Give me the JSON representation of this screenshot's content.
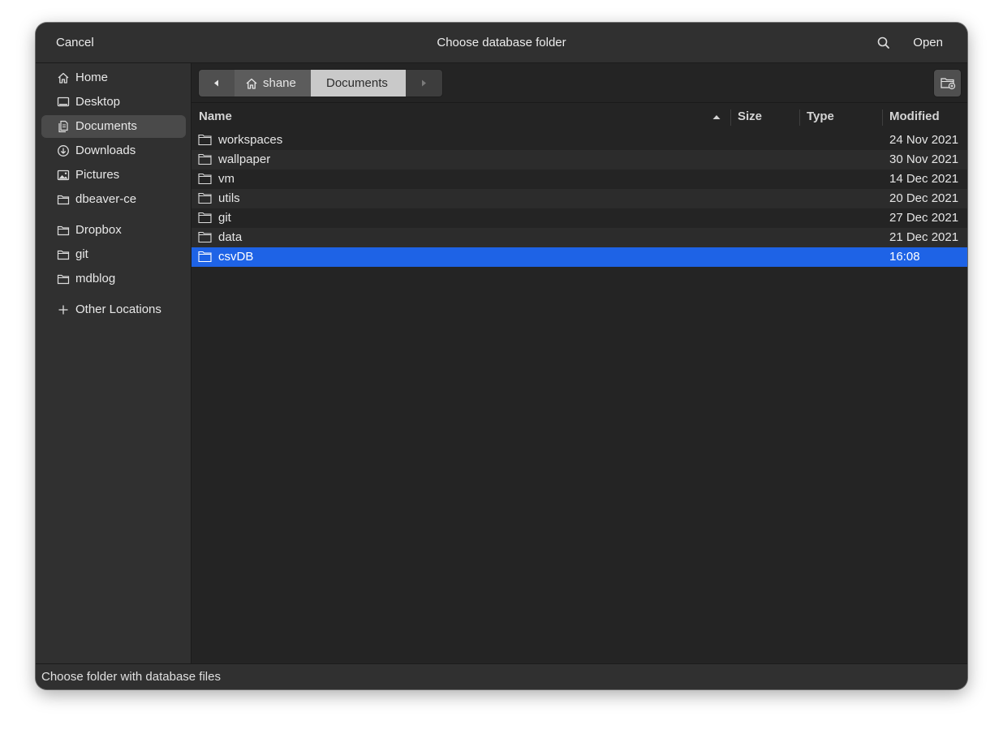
{
  "header": {
    "cancel_label": "Cancel",
    "title": "Choose database folder",
    "open_label": "Open"
  },
  "sidebar": {
    "items": [
      {
        "label": "Home",
        "icon": "home-icon"
      },
      {
        "label": "Desktop",
        "icon": "desktop-icon"
      },
      {
        "label": "Documents",
        "icon": "documents-icon",
        "selected": true
      },
      {
        "label": "Downloads",
        "icon": "downloads-icon"
      },
      {
        "label": "Pictures",
        "icon": "pictures-icon"
      },
      {
        "label": "dbeaver-ce",
        "icon": "folder-icon"
      },
      {
        "label": "Dropbox",
        "icon": "folder-icon"
      },
      {
        "label": "git",
        "icon": "folder-icon"
      },
      {
        "label": "mdblog",
        "icon": "folder-icon"
      },
      {
        "label": "Other Locations",
        "icon": "plus-icon"
      }
    ]
  },
  "pathbar": {
    "home_label": "shane",
    "current_label": "Documents"
  },
  "list": {
    "columns": {
      "name": "Name",
      "size": "Size",
      "type": "Type",
      "modified": "Modified"
    },
    "rows": [
      {
        "name": "workspaces",
        "modified": "24 Nov 2021"
      },
      {
        "name": "wallpaper",
        "modified": "30 Nov 2021"
      },
      {
        "name": "vm",
        "modified": "14 Dec 2021"
      },
      {
        "name": "utils",
        "modified": "20 Dec 2021"
      },
      {
        "name": "git",
        "modified": "27 Dec 2021"
      },
      {
        "name": "data",
        "modified": "21 Dec 2021"
      },
      {
        "name": "csvDB",
        "modified": "16:08",
        "selected": true
      }
    ]
  },
  "status": {
    "text": "Choose folder with database files"
  },
  "colors": {
    "selection": "#1e63e6",
    "window_bg": "#242424",
    "header_bg": "#303030"
  }
}
